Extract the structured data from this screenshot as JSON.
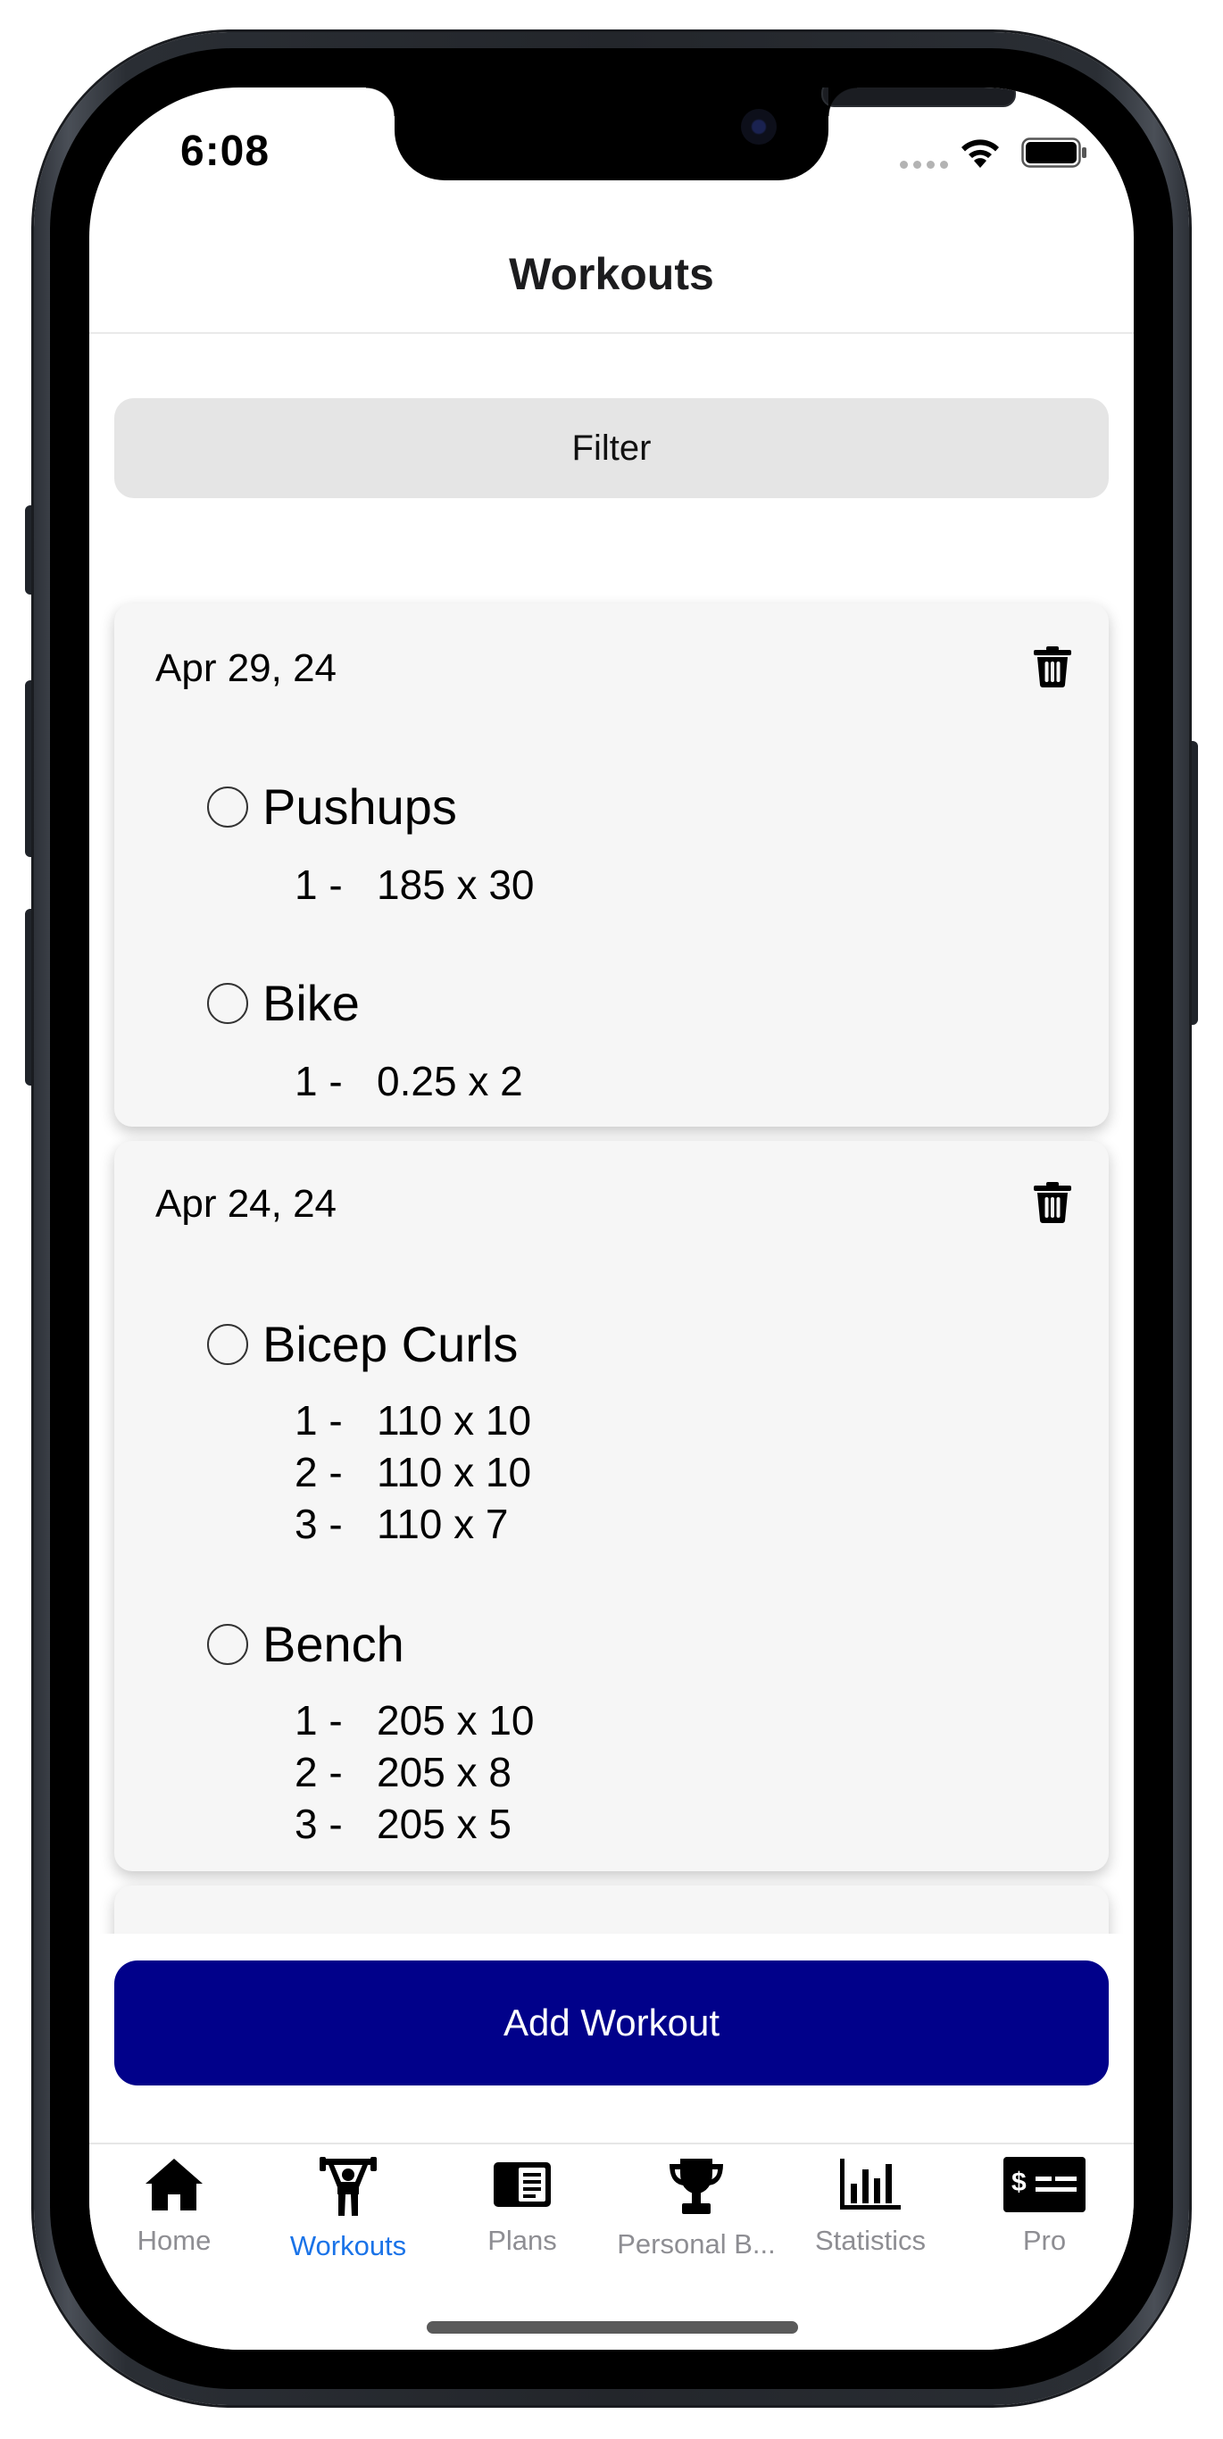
{
  "status_bar": {
    "time": "6:08"
  },
  "nav": {
    "title": "Workouts"
  },
  "filter": {
    "label": "Filter"
  },
  "workouts": [
    {
      "date": "Apr 29, 24",
      "exercises": [
        {
          "name": "Pushups",
          "sets": [
            "1 -   185 x 30"
          ]
        },
        {
          "name": "Bike",
          "sets": [
            "1 -   0.25 x 2"
          ]
        }
      ]
    },
    {
      "date": "Apr 24, 24",
      "exercises": [
        {
          "name": "Bicep Curls",
          "sets": [
            "1 -   110 x 10",
            "2 -   110 x 10",
            "3 -   110 x 7"
          ]
        },
        {
          "name": "Bench",
          "sets": [
            "1 -   205 x 10",
            "2 -   205 x 8",
            "3 -   205 x 5"
          ]
        }
      ]
    }
  ],
  "add_workout": {
    "label": "Add Workout"
  },
  "tab_bar": {
    "active": "Workouts",
    "active_color": "#1a73e8",
    "items": [
      {
        "label": "Home",
        "icon": "house-icon"
      },
      {
        "label": "Workouts",
        "icon": "weightlifter-icon"
      },
      {
        "label": "Plans",
        "icon": "notebook-icon"
      },
      {
        "label": "Personal B...",
        "icon": "trophy-icon"
      },
      {
        "label": "Statistics",
        "icon": "bar-chart-icon"
      },
      {
        "label": "Pro",
        "icon": "money-bill-icon"
      }
    ]
  },
  "colors": {
    "add_button": "#01018a",
    "filter_button": "#e5e5e5",
    "card_background": "#f6f6f6"
  }
}
